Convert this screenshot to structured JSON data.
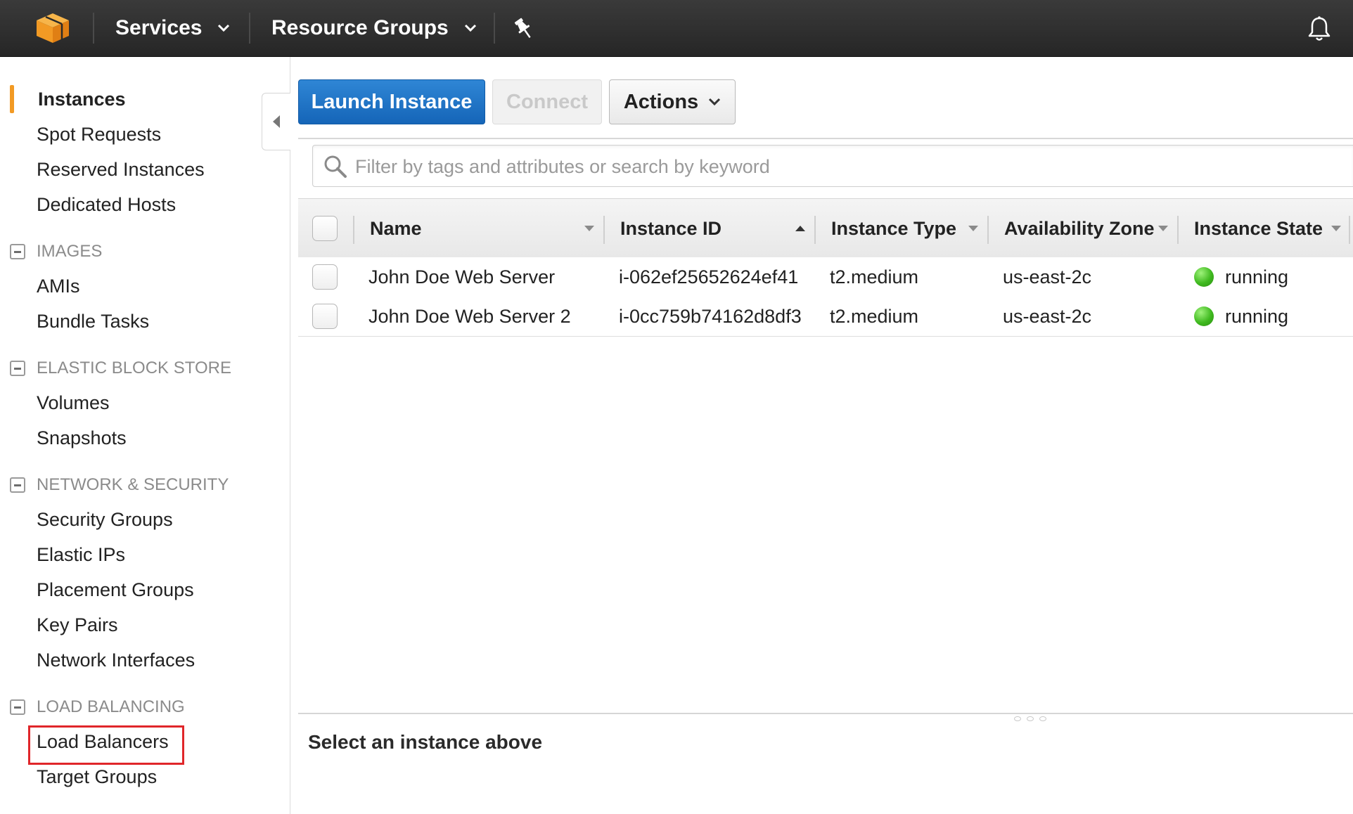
{
  "topbar": {
    "logo_icon": "aws-cube-logo",
    "services_label": "Services",
    "resource_groups_label": "Resource Groups",
    "pin_icon": "pushpin-icon",
    "bell_icon": "bell-icon",
    "logo_color": "#f29a24",
    "bar_color": "#2f2f2f"
  },
  "sidebar": {
    "items": {
      "instances": "Instances",
      "spot_requests": "Spot Requests",
      "reserved_instances": "Reserved Instances",
      "dedicated_hosts": "Dedicated Hosts",
      "amis": "AMIs",
      "bundle_tasks": "Bundle Tasks",
      "volumes": "Volumes",
      "snapshots": "Snapshots",
      "security_groups": "Security Groups",
      "elastic_ips": "Elastic IPs",
      "placement_groups": "Placement Groups",
      "key_pairs": "Key Pairs",
      "network_interfaces": "Network Interfaces",
      "load_balancers": "Load Balancers",
      "target_groups": "Target Groups"
    },
    "sections": {
      "images": "IMAGES",
      "elastic_block_store": "ELASTIC BLOCK STORE",
      "network_security": "NETWORK & SECURITY",
      "load_balancing": "LOAD BALANCING"
    },
    "active_item": "Instances",
    "highlighted_item": "Load Balancers",
    "accent_color": "#f29a24",
    "highlight_color": "#e0262a"
  },
  "toolbar": {
    "launch_label": "Launch Instance",
    "connect_label": "Connect",
    "actions_label": "Actions",
    "launch_color": "#1f73c9"
  },
  "search": {
    "placeholder": "Filter by tags and attributes or search by keyword",
    "value": ""
  },
  "table": {
    "columns": {
      "name": "Name",
      "instance_id": "Instance ID",
      "instance_type": "Instance Type",
      "availability_zone": "Availability Zone",
      "instance_state": "Instance State"
    },
    "rows": [
      {
        "name": "John Doe Web Server",
        "instance_id": "i-062ef25652624ef41",
        "instance_type": "t2.medium",
        "availability_zone": "us-east-2c",
        "instance_state": "running",
        "state_color": "#3fb91f"
      },
      {
        "name": "John Doe Web Server 2",
        "instance_id": "i-0cc759b74162d8df3",
        "instance_type": "t2.medium",
        "availability_zone": "us-east-2c",
        "instance_state": "running",
        "state_color": "#3fb91f"
      }
    ]
  },
  "detail": {
    "message": "Select an instance above"
  }
}
